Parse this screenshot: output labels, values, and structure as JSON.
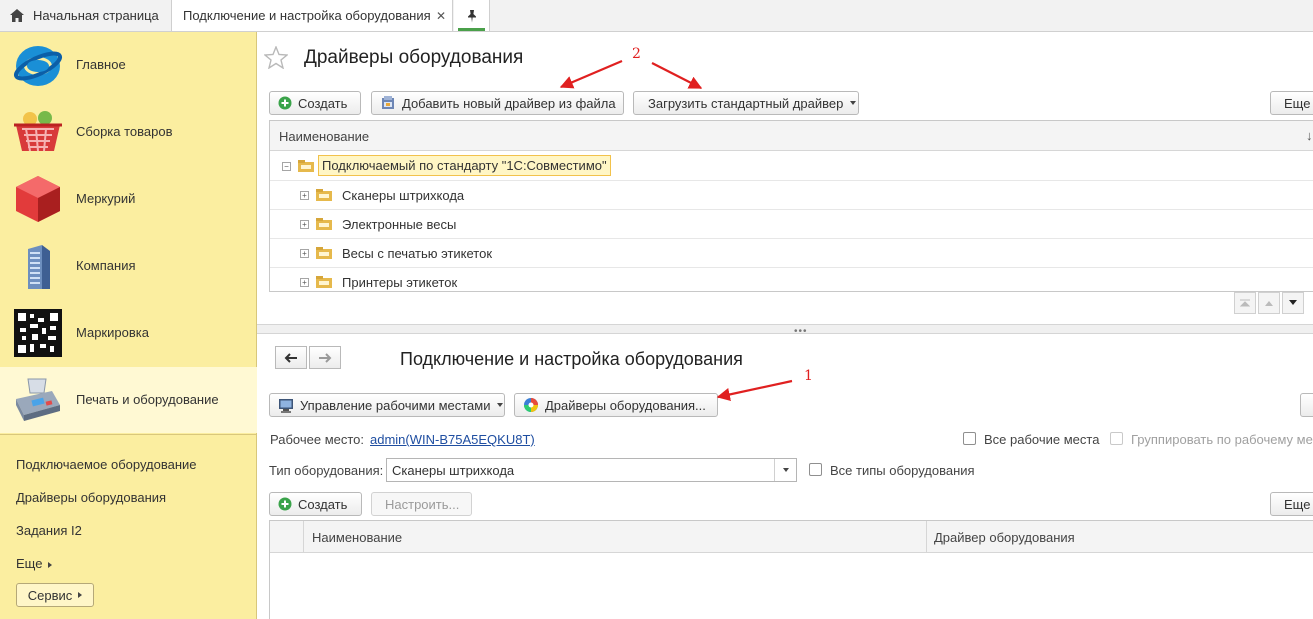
{
  "tabs": {
    "home_label": "Начальная страница",
    "active_label": "Подключение и настройка оборудования",
    "close_glyph": "✕"
  },
  "sidebar": {
    "sections": [
      {
        "label": "Главное",
        "icon": "globe-icon"
      },
      {
        "label": "Сборка товаров",
        "icon": "basket-icon"
      },
      {
        "label": "Меркурий",
        "icon": "red-cube-icon"
      },
      {
        "label": "Компания",
        "icon": "building-icon"
      },
      {
        "label": "Маркировка",
        "icon": "qr-code-icon"
      },
      {
        "label": "Печать и оборудование",
        "icon": "cash-register-icon"
      }
    ],
    "links": [
      "Подключаемое оборудование",
      "Драйверы оборудования",
      "Задания I2",
      "Еще"
    ],
    "service_label": "Сервис"
  },
  "drivers_form": {
    "title": "Драйверы оборудования",
    "create_label": "Создать",
    "add_from_file_label": "Добавить новый драйвер из файла",
    "load_standard_label": "Загрузить стандартный драйвер",
    "more_label": "Еще",
    "table": {
      "column_name": "Наименование",
      "sort_glyph": "↓",
      "root": "Подключаемый по стандарту \"1С:Совместимо\"",
      "children": [
        "Сканеры штрихкода",
        "Электронные весы",
        "Весы с печатью этикеток",
        "Принтеры этикеток"
      ]
    }
  },
  "equipment_form": {
    "title": "Подключение и настройка оборудования",
    "workplaces_button": "Управление рабочими местами",
    "drivers_button": "Драйверы оборудования...",
    "workplace_label": "Рабочее место:",
    "workplace_value": "admin(WIN-B75A5EQKU8T)",
    "all_workplaces_label": "Все рабочие места",
    "group_by_workplace_label": "Группировать по рабочему ме",
    "type_label": "Тип оборудования:",
    "type_value": "Сканеры штрихкода",
    "all_types_label": "Все типы оборудования",
    "create_label": "Создать",
    "configure_label": "Настроить...",
    "more_label": "Еще",
    "columns": [
      "Наименование",
      "Драйвер оборудования"
    ]
  },
  "annotations": {
    "arrow_top_number": "2",
    "arrow_bottom_number": "1",
    "color": "#e02020"
  }
}
